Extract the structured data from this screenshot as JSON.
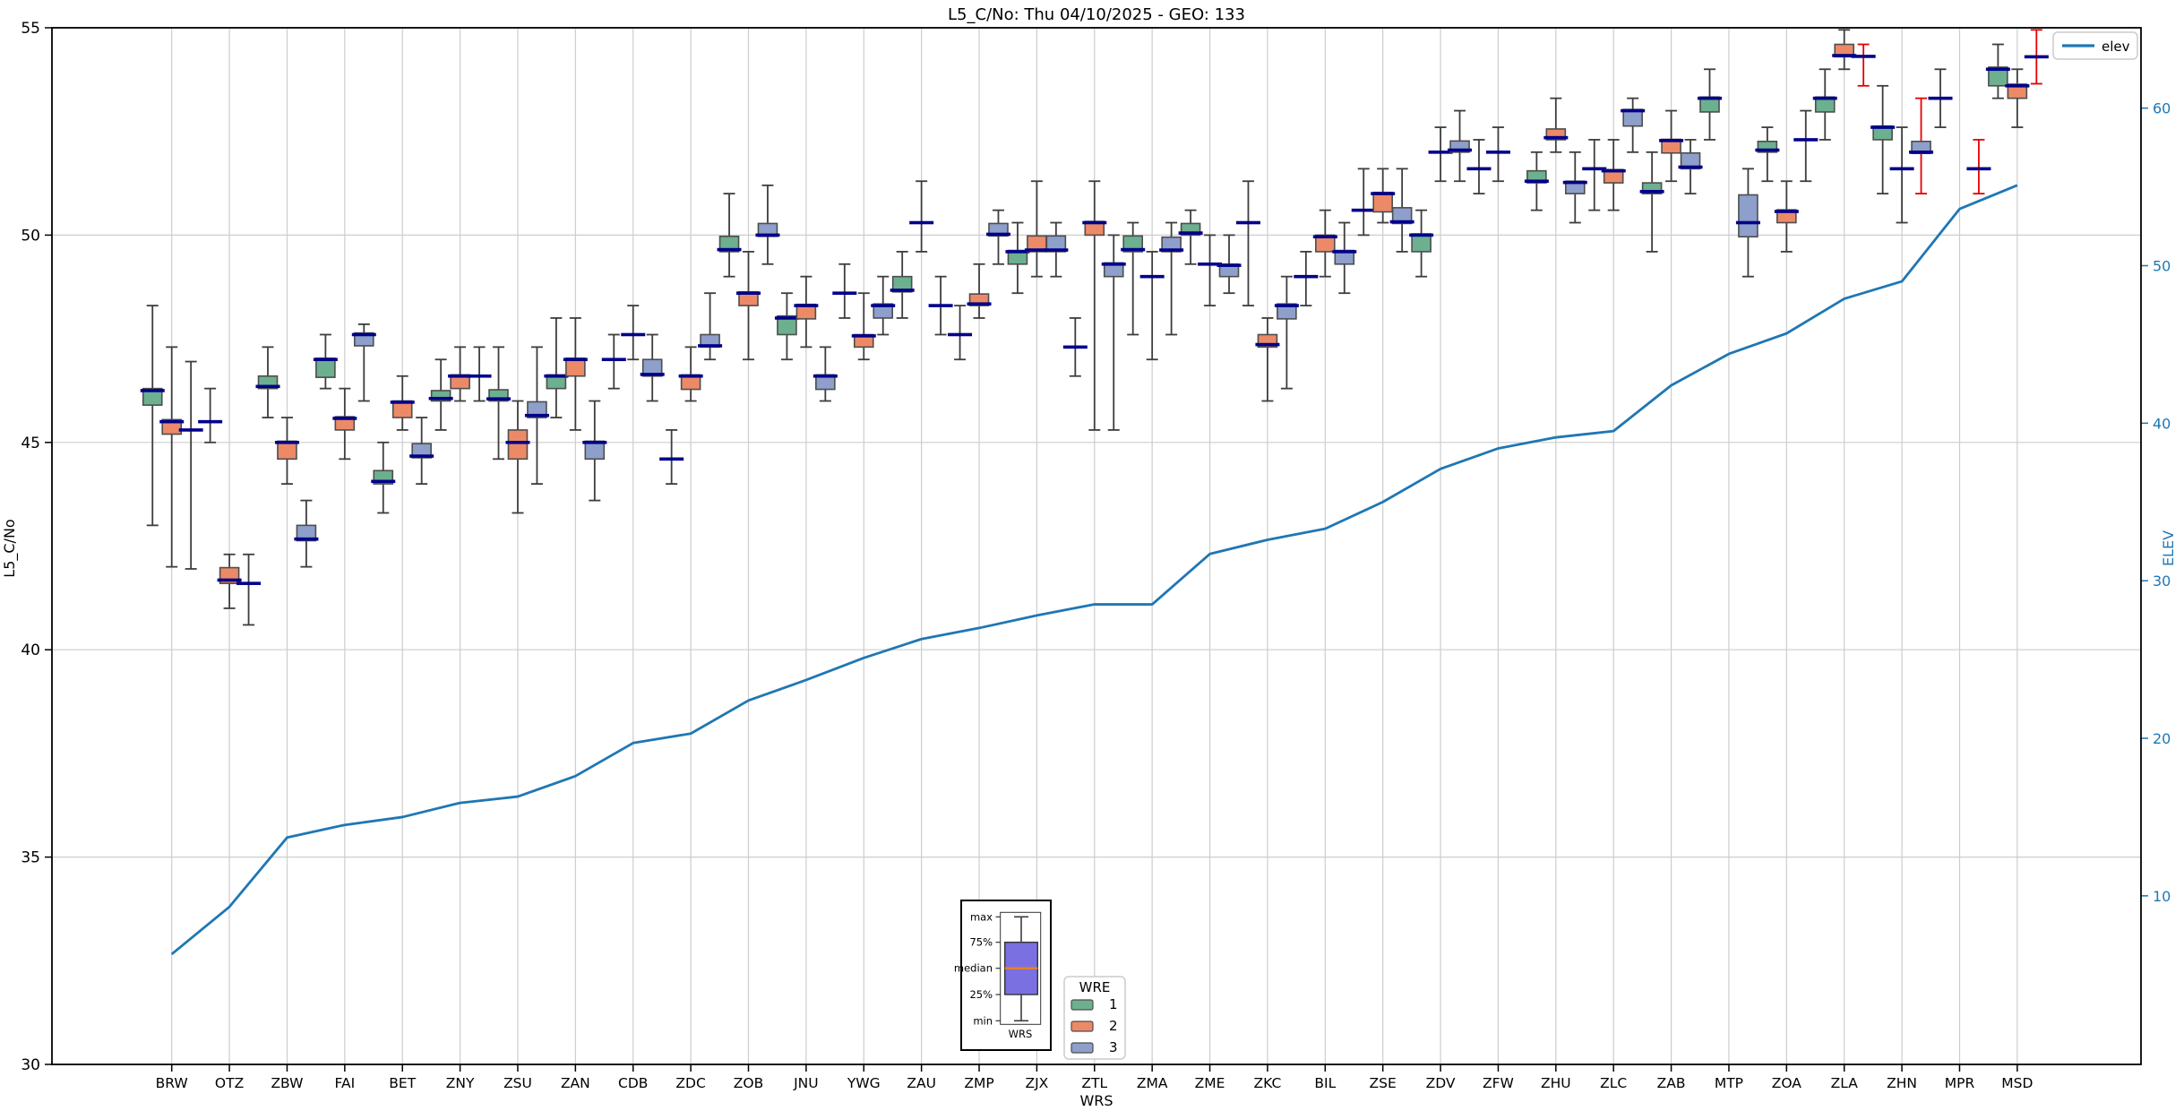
{
  "title": "L5_C/No: Thu 04/10/2025 - GEO: 133",
  "axes": {
    "left": {
      "label": "L5_C/No",
      "ticks": [
        55,
        50,
        45,
        40,
        35,
        30
      ],
      "ylim": [
        30,
        55
      ]
    },
    "right": {
      "label": "ELEV",
      "ticks": [
        60,
        50,
        40,
        30,
        20,
        10
      ],
      "ylim": [
        -0.7,
        65.1
      ]
    },
    "bottom": {
      "label": "WRS"
    }
  },
  "legend_elev": {
    "label": "elev"
  },
  "legend_wre": {
    "title": "WRE",
    "items": [
      {
        "label": "1"
      },
      {
        "label": "2"
      },
      {
        "label": "3"
      }
    ]
  },
  "inset": {
    "labels": {
      "max": "max",
      "p75": "75%",
      "median": "median",
      "p25": "25%",
      "min": "min",
      "xlabel": "WRS"
    },
    "box_color": "#7b70e2",
    "median_color": "#e8821e"
  },
  "colors": {
    "wre": [
      "#6cb08f",
      "#ec8a67",
      "#8d9fca"
    ],
    "box_edge": "#4d4d4d",
    "whisker": "#3d3d3d",
    "median": "#00008b",
    "red_whisker": "#e60000",
    "elev_line": "#1f77b4",
    "grid": "#cdcdcd",
    "axis_text": "#000000",
    "right_axis": "#1f77b4"
  },
  "chart_data": {
    "type": "boxplot+line",
    "categories": [
      "BRW",
      "OTZ",
      "ZBW",
      "FAI",
      "BET",
      "ZNY",
      "ZSU",
      "ZAN",
      "CDB",
      "ZDC",
      "ZOB",
      "JNU",
      "YWG",
      "ZAU",
      "ZMP",
      "ZJX",
      "ZTL",
      "ZMA",
      "ZME",
      "ZKC",
      "BIL",
      "ZSE",
      "ZDV",
      "ZFW",
      "ZHU",
      "ZLC",
      "ZAB",
      "MTP",
      "ZOA",
      "ZLA",
      "ZHN",
      "MPR",
      "MSD"
    ],
    "wre_series": [
      "1",
      "2",
      "3"
    ],
    "boxes": [
      [
        {
          "min": 43.0,
          "q1": 45.9,
          "med": 46.25,
          "q3": 46.3,
          "max": 48.3
        },
        {
          "min": 42.0,
          "q1": 45.2,
          "med": 45.5,
          "q3": 45.55,
          "max": 47.3
        },
        {
          "flat": true,
          "min": 41.95,
          "med": 45.3,
          "max": 46.95
        }
      ],
      [
        {
          "flat": true,
          "min": 45.0,
          "med": 45.5,
          "max": 46.3
        },
        {
          "min": 41.0,
          "q1": 41.6,
          "med": 41.68,
          "q3": 41.98,
          "max": 42.3
        },
        {
          "flat": true,
          "min": 40.6,
          "med": 41.6,
          "max": 42.3
        }
      ],
      [
        {
          "min": 45.6,
          "q1": 46.3,
          "med": 46.35,
          "q3": 46.6,
          "max": 47.3
        },
        {
          "min": 44.0,
          "q1": 44.6,
          "med": 45.0,
          "q3": 45.03,
          "max": 45.6
        },
        {
          "min": 42.0,
          "q1": 42.63,
          "med": 42.67,
          "q3": 43.0,
          "max": 43.6
        }
      ],
      [
        {
          "min": 46.3,
          "q1": 46.57,
          "med": 47.0,
          "q3": 47.03,
          "max": 47.6
        },
        {
          "min": 44.6,
          "q1": 45.3,
          "med": 45.58,
          "q3": 45.62,
          "max": 46.3
        },
        {
          "min": 46.0,
          "q1": 47.33,
          "med": 47.6,
          "q3": 47.64,
          "max": 47.85
        }
      ],
      [
        {
          "min": 43.3,
          "q1": 44.0,
          "med": 44.06,
          "q3": 44.32,
          "max": 45.0
        },
        {
          "min": 45.3,
          "q1": 45.6,
          "med": 45.97,
          "q3": 46.0,
          "max": 46.6
        },
        {
          "min": 44.0,
          "q1": 44.63,
          "med": 44.67,
          "q3": 44.97,
          "max": 45.6
        }
      ],
      [
        {
          "min": 45.3,
          "q1": 46.0,
          "med": 46.06,
          "q3": 46.25,
          "max": 47.0
        },
        {
          "min": 46.0,
          "q1": 46.3,
          "med": 46.6,
          "q3": 46.63,
          "max": 47.3
        },
        {
          "flat": true,
          "min": 46.0,
          "med": 46.6,
          "max": 47.3
        }
      ],
      [
        {
          "min": 44.6,
          "q1": 46.0,
          "med": 46.05,
          "q3": 46.27,
          "max": 47.3
        },
        {
          "min": 43.3,
          "q1": 44.6,
          "med": 45.0,
          "q3": 45.3,
          "max": 46.0
        },
        {
          "min": 44.0,
          "q1": 45.6,
          "med": 45.65,
          "q3": 45.98,
          "max": 47.3
        }
      ],
      [
        {
          "min": 45.6,
          "q1": 46.3,
          "med": 46.6,
          "q3": 46.63,
          "max": 48.0
        },
        {
          "min": 45.3,
          "q1": 46.6,
          "med": 47.0,
          "q3": 47.03,
          "max": 48.0
        },
        {
          "min": 43.6,
          "q1": 44.6,
          "med": 45.0,
          "q3": 45.03,
          "max": 46.0
        }
      ],
      [
        {
          "flat": true,
          "min": 46.3,
          "med": 47.0,
          "max": 47.6
        },
        {
          "flat": true,
          "min": 47.0,
          "med": 47.6,
          "max": 48.3
        },
        {
          "min": 46.0,
          "q1": 46.6,
          "med": 46.64,
          "q3": 47.0,
          "max": 47.6
        }
      ],
      [
        {
          "flat": true,
          "min": 44.0,
          "med": 44.6,
          "max": 45.3
        },
        {
          "min": 46.0,
          "q1": 46.28,
          "med": 46.6,
          "q3": 46.63,
          "max": 47.3
        },
        {
          "min": 47.0,
          "q1": 47.3,
          "med": 47.33,
          "q3": 47.6,
          "max": 48.6
        }
      ],
      [
        {
          "min": 49.0,
          "q1": 49.6,
          "med": 49.65,
          "q3": 49.97,
          "max": 51.0
        },
        {
          "min": 47.0,
          "q1": 48.3,
          "med": 48.6,
          "q3": 48.63,
          "max": 49.6
        },
        {
          "min": 49.3,
          "q1": 49.97,
          "med": 50.0,
          "q3": 50.28,
          "max": 51.2
        }
      ],
      [
        {
          "min": 47.0,
          "q1": 47.6,
          "med": 48.0,
          "q3": 48.05,
          "max": 48.6
        },
        {
          "min": 47.3,
          "q1": 47.98,
          "med": 48.3,
          "q3": 48.33,
          "max": 49.0
        },
        {
          "min": 46.0,
          "q1": 46.28,
          "med": 46.6,
          "q3": 46.63,
          "max": 47.3
        }
      ],
      [
        {
          "flat": true,
          "min": 48.0,
          "med": 48.6,
          "max": 49.3
        },
        {
          "min": 47.0,
          "q1": 47.3,
          "med": 47.57,
          "q3": 47.6,
          "max": 48.6
        },
        {
          "min": 47.6,
          "q1": 48.0,
          "med": 48.3,
          "q3": 48.34,
          "max": 49.0
        }
      ],
      [
        {
          "min": 48.0,
          "q1": 48.63,
          "med": 48.67,
          "q3": 49.0,
          "max": 49.6
        },
        {
          "flat": true,
          "min": 49.6,
          "med": 50.3,
          "max": 51.3
        },
        {
          "flat": true,
          "min": 47.6,
          "med": 48.3,
          "max": 49.0
        }
      ],
      [
        {
          "flat": true,
          "min": 47.0,
          "med": 47.6,
          "max": 48.3
        },
        {
          "min": 48.0,
          "q1": 48.3,
          "med": 48.34,
          "q3": 48.58,
          "max": 49.3
        },
        {
          "min": 49.3,
          "q1": 49.98,
          "med": 50.02,
          "q3": 50.28,
          "max": 50.6
        }
      ],
      [
        {
          "min": 48.6,
          "q1": 49.3,
          "med": 49.6,
          "q3": 49.63,
          "max": 50.3
        },
        {
          "min": 49.0,
          "q1": 49.6,
          "med": 49.64,
          "q3": 49.98,
          "max": 51.3
        },
        {
          "min": 49.0,
          "q1": 49.6,
          "med": 49.64,
          "q3": 49.98,
          "max": 50.3
        }
      ],
      [
        {
          "flat": true,
          "min": 46.6,
          "med": 47.3,
          "max": 48.0
        },
        {
          "min": 45.3,
          "q1": 50.0,
          "med": 50.3,
          "q3": 50.33,
          "max": 51.3
        },
        {
          "min": 45.3,
          "q1": 49.0,
          "med": 49.3,
          "q3": 49.33,
          "max": 50.0
        }
      ],
      [
        {
          "min": 47.6,
          "q1": 49.6,
          "med": 49.65,
          "q3": 49.98,
          "max": 50.3
        },
        {
          "flat": true,
          "min": 47.0,
          "med": 49.0,
          "max": 49.6
        },
        {
          "min": 47.6,
          "q1": 49.6,
          "med": 49.64,
          "q3": 49.95,
          "max": 50.3
        }
      ],
      [
        {
          "min": 49.3,
          "q1": 50.0,
          "med": 50.05,
          "q3": 50.28,
          "max": 50.6
        },
        {
          "flat": true,
          "min": 48.3,
          "med": 49.3,
          "max": 50.0
        },
        {
          "min": 48.6,
          "q1": 49.0,
          "med": 49.27,
          "q3": 49.3,
          "max": 50.0
        }
      ],
      [
        {
          "flat": true,
          "min": 48.3,
          "med": 50.3,
          "max": 51.3
        },
        {
          "min": 46.0,
          "q1": 47.3,
          "med": 47.36,
          "q3": 47.6,
          "max": 48.0
        },
        {
          "min": 46.3,
          "q1": 47.98,
          "med": 48.3,
          "q3": 48.34,
          "max": 49.0
        }
      ],
      [
        {
          "flat": true,
          "min": 48.3,
          "med": 49.0,
          "max": 49.6
        },
        {
          "min": 49.0,
          "q1": 49.6,
          "med": 49.96,
          "q3": 50.0,
          "max": 50.6
        },
        {
          "min": 48.6,
          "q1": 49.3,
          "med": 49.6,
          "q3": 49.63,
          "max": 50.3
        }
      ],
      [
        {
          "flat": true,
          "min": 50.0,
          "med": 50.6,
          "max": 51.6
        },
        {
          "min": 50.3,
          "q1": 50.56,
          "med": 51.0,
          "q3": 51.03,
          "max": 51.6
        },
        {
          "min": 49.6,
          "q1": 50.28,
          "med": 50.32,
          "q3": 50.66,
          "max": 51.6
        }
      ],
      [
        {
          "min": 49.0,
          "q1": 49.6,
          "med": 50.0,
          "q3": 50.03,
          "max": 50.6
        },
        {
          "flat": true,
          "min": 51.3,
          "med": 52.0,
          "max": 52.6
        },
        {
          "min": 51.3,
          "q1": 52.0,
          "med": 52.05,
          "q3": 52.27,
          "max": 53.0
        }
      ],
      [
        {
          "flat": true,
          "min": 51.0,
          "med": 51.6,
          "max": 52.3
        },
        {
          "flat": true,
          "min": 51.3,
          "med": 52.0,
          "max": 52.6
        },
        null
      ],
      [
        {
          "min": 50.6,
          "q1": 51.26,
          "med": 51.3,
          "q3": 51.55,
          "max": 52.0
        },
        {
          "min": 52.0,
          "q1": 52.3,
          "med": 52.35,
          "q3": 52.56,
          "max": 53.3
        },
        {
          "min": 50.3,
          "q1": 51.0,
          "med": 51.27,
          "q3": 51.3,
          "max": 52.0
        }
      ],
      [
        {
          "flat": true,
          "min": 50.6,
          "med": 51.6,
          "max": 52.3
        },
        {
          "min": 50.6,
          "q1": 51.26,
          "med": 51.55,
          "q3": 51.58,
          "max": 52.3
        },
        {
          "min": 52.0,
          "q1": 52.63,
          "med": 53.0,
          "q3": 53.03,
          "max": 53.3
        }
      ],
      [
        {
          "min": 49.6,
          "q1": 51.0,
          "med": 51.05,
          "q3": 51.26,
          "max": 52.0
        },
        {
          "min": 51.3,
          "q1": 51.98,
          "med": 52.28,
          "q3": 52.31,
          "max": 53.0
        },
        {
          "min": 51.0,
          "q1": 51.6,
          "med": 51.64,
          "q3": 51.98,
          "max": 52.3
        }
      ],
      [
        {
          "min": 52.3,
          "q1": 52.97,
          "med": 53.3,
          "q3": 53.33,
          "max": 54.0
        },
        null,
        {
          "min": 49.0,
          "q1": 49.96,
          "med": 50.3,
          "q3": 50.97,
          "max": 51.6
        }
      ],
      [
        {
          "min": 51.3,
          "q1": 52.0,
          "med": 52.05,
          "q3": 52.26,
          "max": 52.6
        },
        {
          "min": 49.6,
          "q1": 50.3,
          "med": 50.57,
          "q3": 50.61,
          "max": 51.3
        },
        {
          "flat": true,
          "min": 51.3,
          "med": 52.3,
          "max": 53.0
        }
      ],
      [
        {
          "min": 52.3,
          "q1": 52.97,
          "med": 53.3,
          "q3": 53.33,
          "max": 54.0
        },
        {
          "min": 54.0,
          "q1": 54.3,
          "med": 54.33,
          "q3": 54.6,
          "max": 54.95
        },
        {
          "flat": true,
          "red": true,
          "min": 53.6,
          "med": 54.31,
          "max": 54.6
        }
      ],
      [
        {
          "min": 51.0,
          "q1": 52.3,
          "med": 52.6,
          "q3": 52.63,
          "max": 53.6
        },
        {
          "flat": true,
          "min": 50.3,
          "med": 51.6,
          "max": 52.6
        },
        {
          "red": true,
          "min": 51.0,
          "q1": 51.97,
          "med": 52.0,
          "q3": 52.26,
          "max": 53.3
        }
      ],
      [
        {
          "flat": true,
          "min": 52.6,
          "med": 53.3,
          "max": 54.0
        },
        null,
        {
          "flat": true,
          "red": true,
          "min": 51.0,
          "med": 51.6,
          "max": 52.3
        }
      ],
      [
        {
          "min": 53.3,
          "q1": 53.6,
          "med": 54.0,
          "q3": 54.05,
          "max": 54.6
        },
        {
          "min": 52.6,
          "q1": 53.3,
          "med": 53.6,
          "q3": 53.64,
          "max": 54.0
        },
        {
          "flat": true,
          "red": true,
          "min": 53.65,
          "med": 54.3,
          "max": 54.95
        }
      ]
    ],
    "elev": [
      6.3,
      9.3,
      13.7,
      14.5,
      15.0,
      15.9,
      16.3,
      17.6,
      19.7,
      20.3,
      22.4,
      23.7,
      25.1,
      26.3,
      27.0,
      27.8,
      28.5,
      28.5,
      31.7,
      32.6,
      33.3,
      35.0,
      37.1,
      38.4,
      39.1,
      39.5,
      42.4,
      44.4,
      45.7,
      47.9,
      49.0,
      53.6,
      55.1
    ],
    "grid": true,
    "legend_position": "elev top-right; WRE bottom-center"
  }
}
